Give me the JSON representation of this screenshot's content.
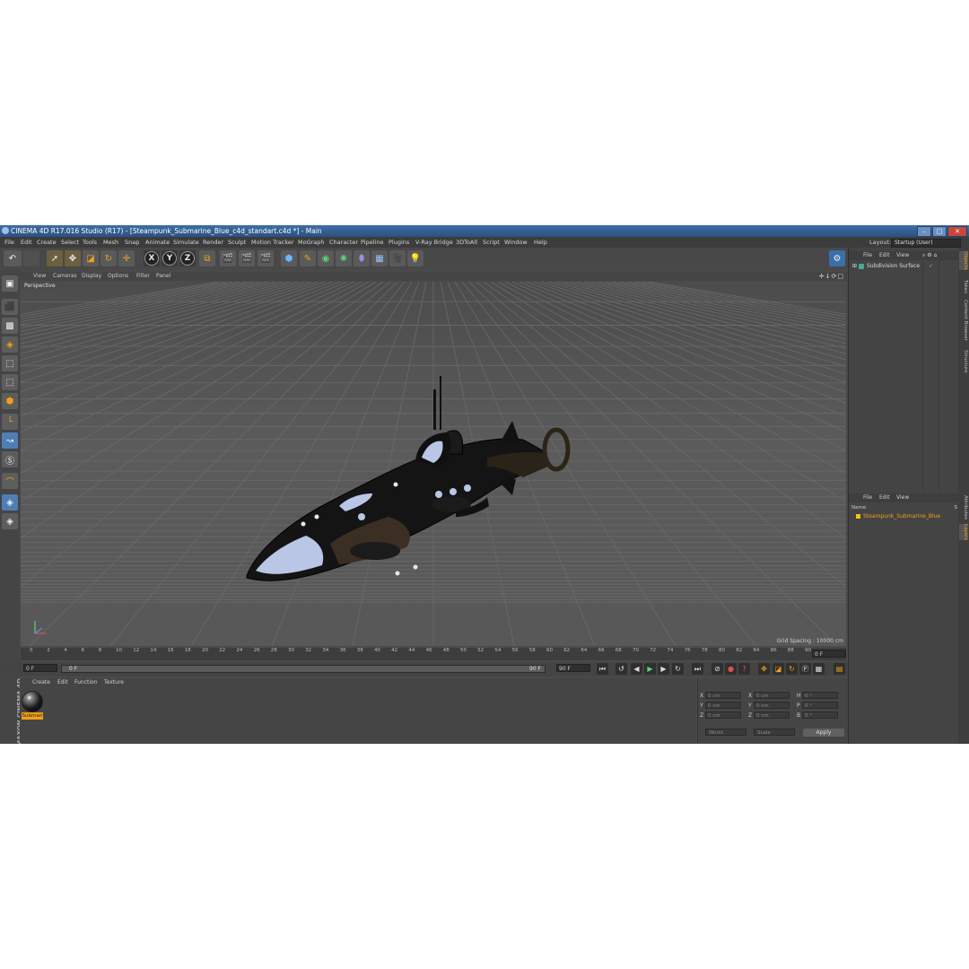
{
  "window": {
    "title": "CINEMA 4D R17.016 Studio (R17) - [Steampunk_Submarine_Blue_c4d_standart.c4d *] - Main",
    "buttons": [
      "–",
      "□",
      "✕"
    ]
  },
  "menubar": {
    "items": [
      "File",
      "Edit",
      "Create",
      "Select",
      "Tools",
      "Mesh",
      "Snap",
      "Animate",
      "Simulate",
      "Render",
      "Sculpt",
      "Motion Tracker",
      "MoGraph",
      "Character",
      "Pipeline",
      "Plugins",
      "V-Ray Bridge",
      "3DToAll",
      "Script",
      "Window",
      "Help"
    ],
    "layout_label": "Layout:",
    "layout_value": "Startup (User)"
  },
  "toolbar": {
    "axis_x": "X",
    "axis_y": "Y",
    "axis_z": "Z"
  },
  "viewport": {
    "menu": [
      "View",
      "Cameras",
      "Display",
      "Options",
      "Filter",
      "Panel"
    ],
    "label": "Perspective",
    "grid_spacing": "Grid Spacing : 10000 cm",
    "nav_icons": "✛↓⟳□"
  },
  "timeline": {
    "ticks": [
      "0",
      "2",
      "4",
      "6",
      "8",
      "10",
      "12",
      "14",
      "16",
      "18",
      "20",
      "22",
      "24",
      "26",
      "28",
      "30",
      "32",
      "34",
      "36",
      "38",
      "40",
      "42",
      "44",
      "46",
      "48",
      "50",
      "52",
      "54",
      "56",
      "58",
      "60",
      "62",
      "64",
      "66",
      "68",
      "70",
      "72",
      "74",
      "76",
      "78",
      "80",
      "82",
      "84",
      "86",
      "88",
      "90"
    ],
    "current_frame": "0 F",
    "start_frame": "0 F",
    "slider_start": "0 F",
    "slider_end": "90 F",
    "end_frame": "90 F"
  },
  "material_manager": {
    "menu": [
      "Create",
      "Edit",
      "Function",
      "Texture"
    ],
    "material_name": "Submari"
  },
  "branding": "MAXON CINEMA 4D",
  "coordinates": {
    "rows": [
      {
        "a": "X",
        "av": "0 cm",
        "b": "X",
        "bv": "0 cm",
        "c": "H",
        "cv": "0 °"
      },
      {
        "a": "Y",
        "av": "0 cm",
        "b": "Y",
        "bv": "0 cm",
        "c": "P",
        "cv": "0 °"
      },
      {
        "a": "Z",
        "av": "0 cm",
        "b": "Z",
        "bv": "0 cm",
        "c": "B",
        "cv": "0 °"
      }
    ],
    "mode": "World",
    "scale_mode": "Scale",
    "apply": "Apply"
  },
  "object_manager": {
    "menu": [
      "File",
      "Edit",
      "View"
    ],
    "objects": [
      "Subdivision Surface"
    ]
  },
  "layer_manager": {
    "menu": [
      "File",
      "Edit",
      "View"
    ],
    "col_name": "Name",
    "col_s": "S",
    "layers": [
      "Steampunk_Submarine_Blue"
    ]
  },
  "side_tabs": [
    "Objects",
    "Takes",
    "Content Browser",
    "Structure",
    "Attributes",
    "Layers"
  ],
  "colors": {
    "accent": "#f0a019",
    "title_blue": "#3f6ea4",
    "panel": "#4a4a4a"
  }
}
